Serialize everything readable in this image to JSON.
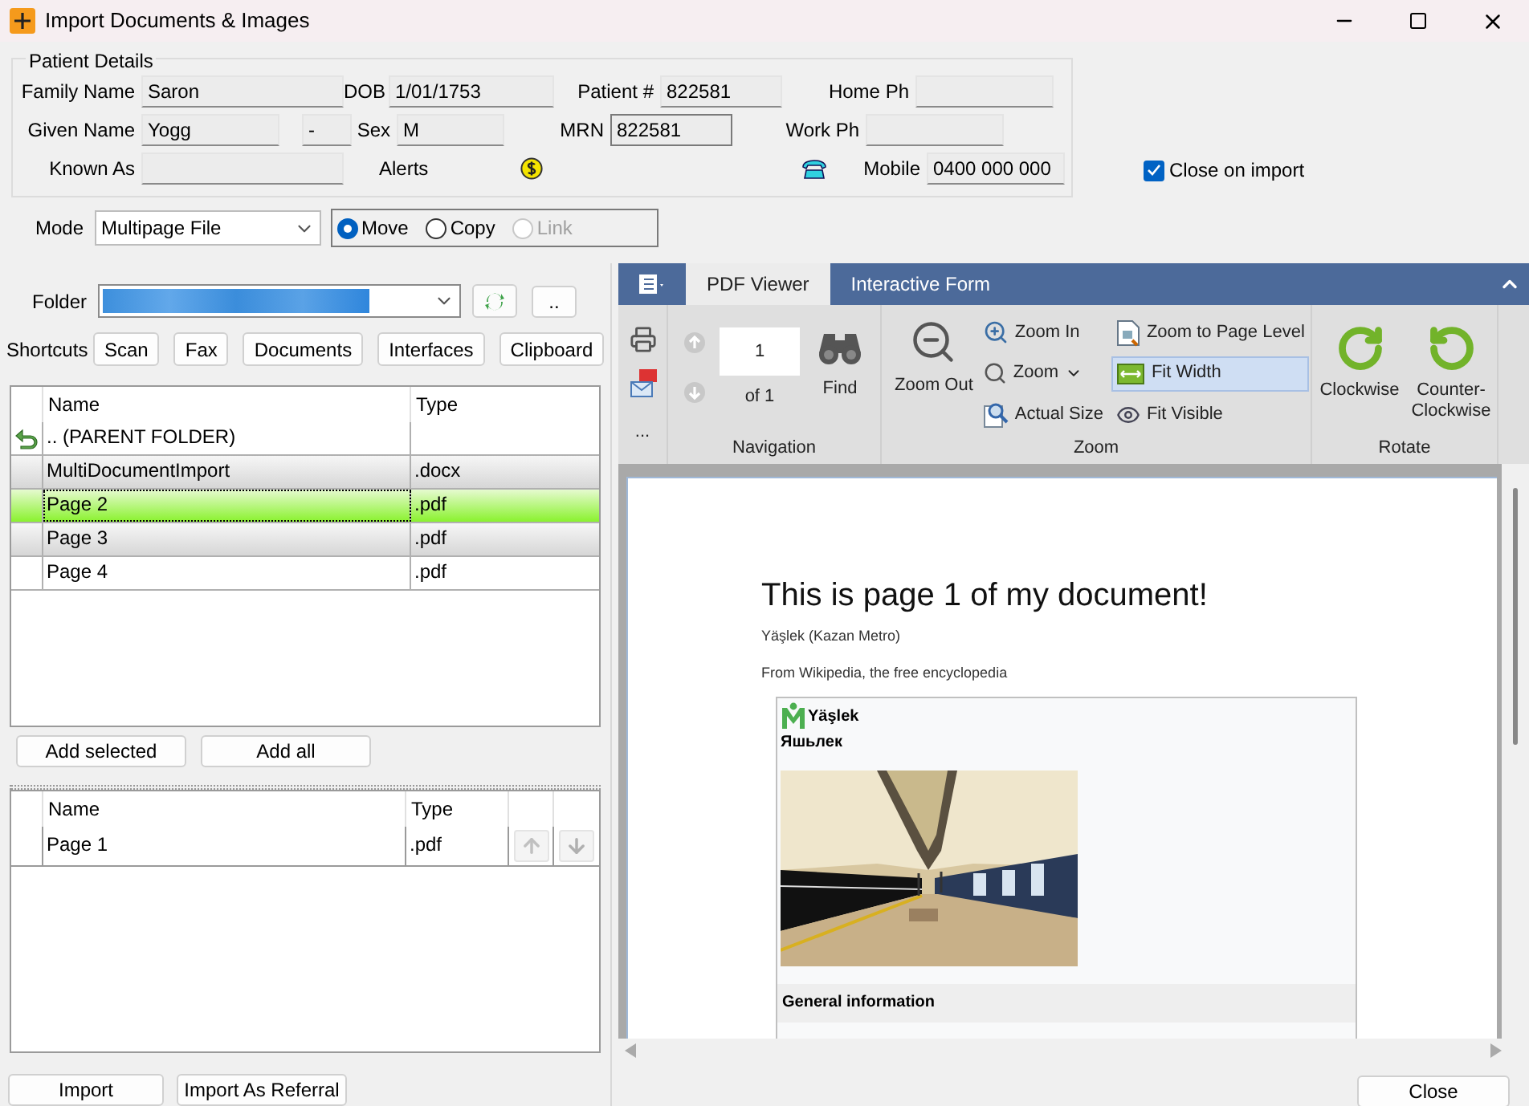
{
  "window": {
    "title": "Import Documents & Images"
  },
  "patient": {
    "legend": "Patient Details",
    "rows": [
      [
        {
          "kind": "field",
          "label": "Family Name",
          "value": "Saron",
          "focused": false
        },
        {
          "kind": "field",
          "label": "DOB",
          "value": "1/01/1753",
          "focused": false
        },
        {
          "kind": "field",
          "label": "Patient #",
          "value": "822581",
          "focused": false
        },
        {
          "kind": "field",
          "label": "Home Ph",
          "focused": false
        }
      ],
      [
        {
          "kind": "split-field",
          "label": "Given Name",
          "value": "Yogg",
          "value_2": "-",
          "focused": false
        },
        {
          "kind": "field",
          "label": "Sex",
          "value": "M",
          "focused": false
        },
        {
          "kind": "field",
          "label": "MRN",
          "value": "822581",
          "focused": true
        },
        {
          "kind": "field",
          "label": "Work Ph",
          "focused": false
        }
      ],
      [
        {
          "kind": "field",
          "label": "Known As",
          "focused": false
        },
        {
          "kind": "alerts",
          "label": "Alerts"
        },
        {
          "kind": "phone-field",
          "label": "Mobile",
          "value": "0400 000 000",
          "focused": false
        }
      ]
    ]
  },
  "close_on_import": {
    "label": "Close on import",
    "checked": true
  },
  "mode": {
    "label": "Mode",
    "value": "Multipage File",
    "options": [
      {
        "label": "Move",
        "selected": true,
        "disabled": false
      },
      {
        "label": "Copy",
        "selected": false,
        "disabled": false
      },
      {
        "label": "Link",
        "selected": false,
        "disabled": true
      }
    ]
  },
  "folder": {
    "label": "Folder",
    "more_button": ".."
  },
  "shortcuts": {
    "label": "Shortcuts",
    "buttons": [
      "Scan",
      "Fax",
      "Documents",
      "Interfaces",
      "Clipboard"
    ]
  },
  "file_table": {
    "columns": [
      "Name",
      "Type"
    ],
    "rows": [
      {
        "kind": "parent",
        "name": ".. (PARENT FOLDER)",
        "selected": false,
        "focused": false
      },
      {
        "kind": "file",
        "name": "MultiDocumentImport",
        "type": ".docx",
        "selected": true,
        "focused": false
      },
      {
        "kind": "file",
        "name": "Page 2",
        "type": ".pdf",
        "selected": true,
        "focused": true
      },
      {
        "kind": "file",
        "name": "Page 3",
        "type": ".pdf",
        "selected": true,
        "focused": false
      },
      {
        "kind": "file",
        "name": "Page 4",
        "type": ".pdf",
        "selected": false,
        "focused": false
      }
    ]
  },
  "add_buttons": [
    "Add selected",
    "Add all"
  ],
  "import_table": {
    "columns": [
      "Name",
      "Type"
    ],
    "rows": [
      {
        "name": "Page 1",
        "type": ".pdf",
        "can_move_up": false,
        "can_move_down": false
      }
    ]
  },
  "bottom_buttons": [
    "Import",
    "Import As Referral"
  ],
  "viewer": {
    "tabs": [
      {
        "label": "PDF Viewer",
        "selected": true
      },
      {
        "label": "Interactive Form",
        "selected": false
      }
    ],
    "ribbon": {
      "misc_label": "...",
      "navigation": {
        "label": "Navigation",
        "page": "1",
        "of": "of 1",
        "find": "Find"
      },
      "zoom": {
        "label": "Zoom",
        "zoom_out": "Zoom Out",
        "items": [
          {
            "kind": "zoom-in",
            "label": "Zoom In",
            "selected": false
          },
          {
            "kind": "zoom-menu",
            "label": "Zoom",
            "selected": false
          },
          {
            "kind": "actual-size",
            "label": "Actual Size",
            "selected": false
          },
          {
            "kind": "page-level",
            "label": "Zoom to Page Level",
            "selected": false
          },
          {
            "kind": "fit-width",
            "label": "Fit Width",
            "selected": true
          },
          {
            "kind": "fit-visible",
            "label": "Fit Visible",
            "selected": false
          }
        ]
      },
      "rotate": {
        "label": "Rotate",
        "buttons": [
          {
            "kind": "cw",
            "label": "Clockwise"
          },
          {
            "kind": "ccw",
            "label": "Counter-Clockwise"
          }
        ]
      }
    },
    "document": {
      "heading": "This is page 1 of my document!",
      "subtitle": "Yäşlek (Kazan Metro)",
      "source": "From Wikipedia, the free encyclopedia",
      "infobox": {
        "title": "Yäşlek",
        "native_name": "Яшьлек",
        "section": "General information"
      }
    }
  },
  "close_button": "Close"
}
